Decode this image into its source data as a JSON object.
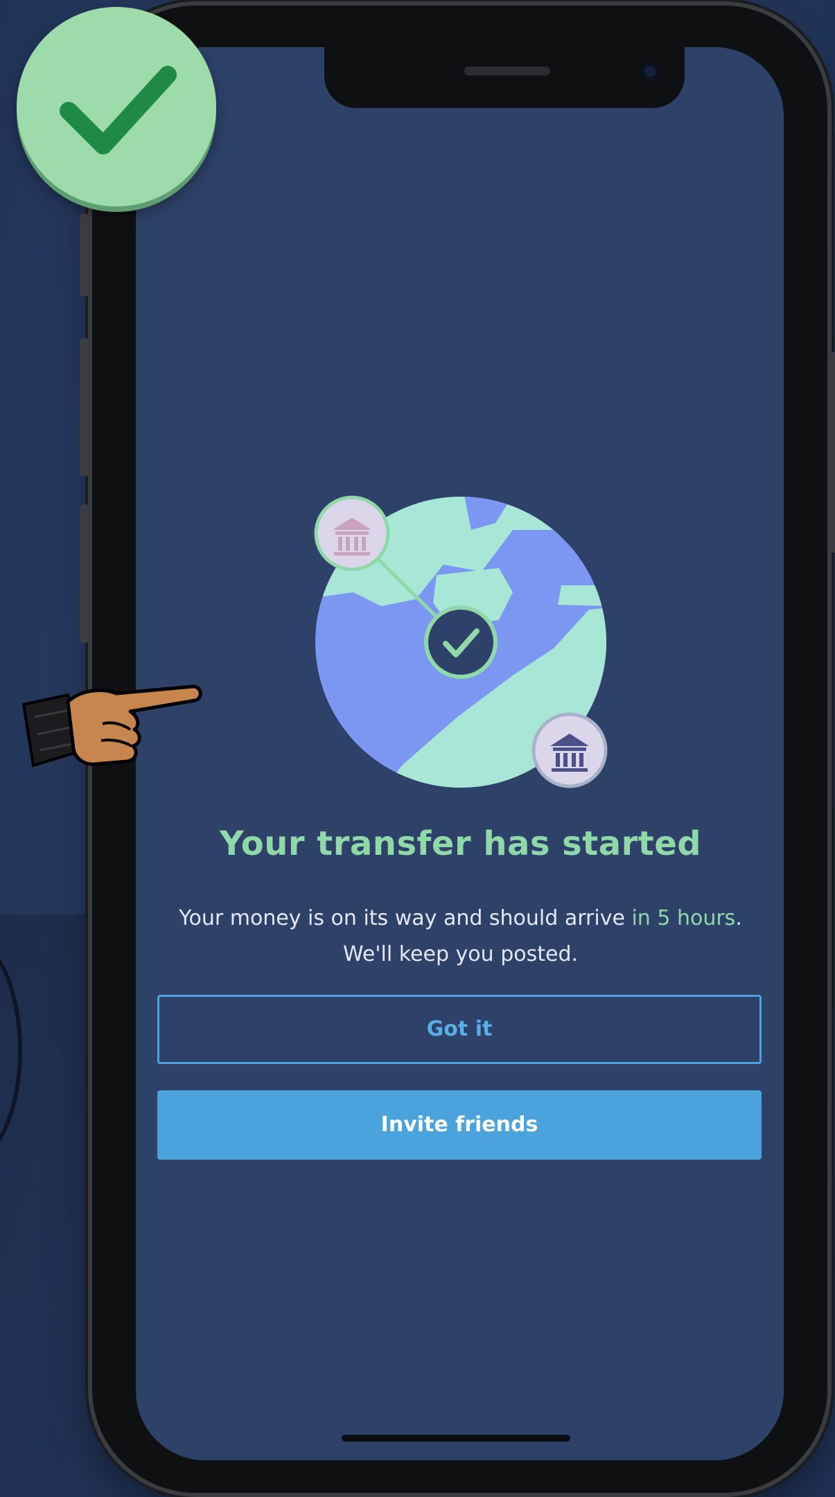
{
  "colors": {
    "background": "#27395f",
    "screen": "#2d4169",
    "accent_green": "#8fd9a8",
    "primary_blue": "#4aa3dd",
    "globe_blue": "#7b97f2",
    "land_green": "#a8e7d6"
  },
  "icons": {
    "success_badge": "check-icon",
    "illustration": "globe-transfer-illustration",
    "bank_source": "bank-icon",
    "bank_destination": "bank-icon",
    "center": "check-icon",
    "pointer": "pointing-hand-icon"
  },
  "transfer": {
    "title": "Your transfer has started",
    "description_prefix": "Your money is on its way and should arrive ",
    "eta": "in 5 hours",
    "description_suffix": ".",
    "description_line2": "We'll keep you posted."
  },
  "actions": {
    "got_it_label": "Got it",
    "invite_friends_label": "Invite friends"
  }
}
